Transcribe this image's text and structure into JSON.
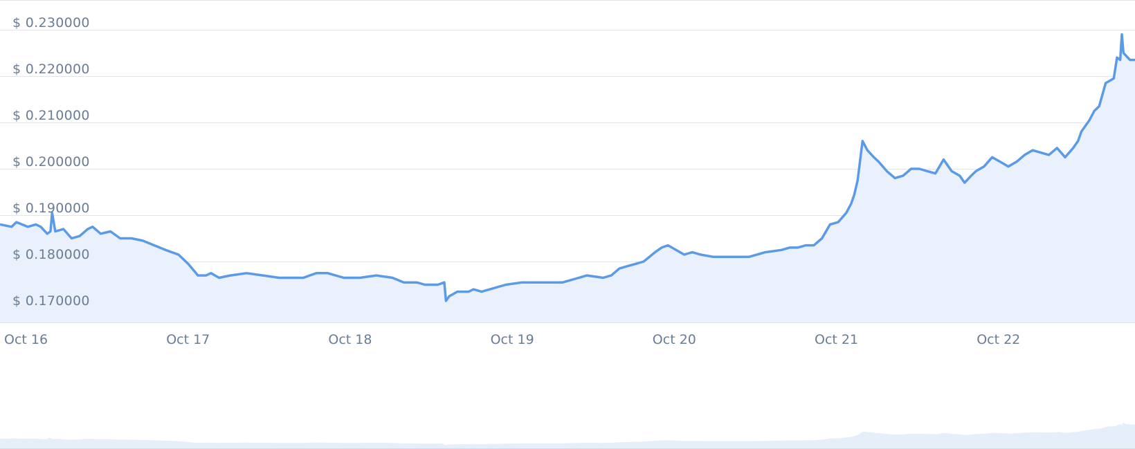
{
  "colors": {
    "line": "#5a9ae6",
    "area_fill": "#eaf1fc",
    "grid": "#e2e6eb",
    "axis_text": "#6b7c93",
    "navigator_fill": "#e6eefa"
  },
  "chart_data": {
    "type": "area",
    "title": "",
    "xlabel": "",
    "ylabel": "",
    "ylim": [
      0.167,
      0.235
    ],
    "grid": true,
    "y_tick_values": [
      0.17,
      0.18,
      0.19,
      0.2,
      0.21,
      0.22,
      0.23
    ],
    "y_tick_labels": [
      "$ 0.170000",
      "$ 0.180000",
      "$ 0.190000",
      "$ 0.200000",
      "$ 0.210000",
      "$ 0.220000",
      "$ 0.230000"
    ],
    "x_tick_values": [
      0,
      1,
      2,
      3,
      4,
      5,
      6
    ],
    "x_tick_labels": [
      "Oct 16",
      "Oct 17",
      "Oct 18",
      "Oct 19",
      "Oct 20",
      "Oct 21",
      "Oct 22"
    ],
    "xlim": [
      0,
      6.97
    ],
    "series": [
      {
        "x": [
          0,
          0.05,
          0.08,
          0.15,
          0.2,
          0.23,
          0.27,
          0.29,
          0.3,
          0.32,
          0.37,
          0.42,
          0.47,
          0.52,
          0.55,
          0.6,
          0.66,
          0.72,
          0.79,
          0.86,
          0.93,
          1.0,
          1.08,
          1.14,
          1.2,
          1.25,
          1.28,
          1.33,
          1.4,
          1.5,
          1.6,
          1.7,
          1.85,
          1.93,
          2.0,
          2.1,
          2.2,
          2.3,
          2.4,
          2.47,
          2.55,
          2.6,
          2.68,
          2.72,
          2.73,
          2.75,
          2.8,
          2.87,
          2.9,
          2.95,
          3.0,
          3.1,
          3.2,
          3.28,
          3.35,
          3.45,
          3.55,
          3.6,
          3.7,
          3.75,
          3.8,
          3.85,
          3.9,
          3.95,
          4.02,
          4.06,
          4.1,
          4.2,
          4.25,
          4.3,
          4.38,
          4.42,
          4.5,
          4.6,
          4.7,
          4.8,
          4.85,
          4.9,
          4.95,
          5.0,
          5.05,
          5.1,
          5.15,
          5.2,
          5.23,
          5.25,
          5.27,
          5.3,
          5.33,
          5.37,
          5.4,
          5.45,
          5.5,
          5.55,
          5.6,
          5.65,
          5.7,
          5.75,
          5.8,
          5.85,
          5.9,
          5.93,
          5.97,
          6.0,
          6.05,
          6.1,
          6.15,
          6.2,
          6.25,
          6.3,
          6.35,
          6.4,
          6.45,
          6.5,
          6.55,
          6.6,
          6.63,
          6.65,
          6.7,
          6.73,
          6.76,
          6.8,
          6.85,
          6.87,
          6.89,
          6.9,
          6.91,
          6.95,
          6.97
        ],
        "y": [
          0.188,
          0.1875,
          0.1885,
          0.1875,
          0.188,
          0.1875,
          0.186,
          0.1865,
          0.1905,
          0.1865,
          0.187,
          0.185,
          0.1855,
          0.187,
          0.1875,
          0.186,
          0.1865,
          0.185,
          0.185,
          0.1845,
          0.1835,
          0.1825,
          0.1815,
          0.1795,
          0.177,
          0.177,
          0.1775,
          0.1765,
          0.177,
          0.1775,
          0.177,
          0.1765,
          0.1765,
          0.1775,
          0.1775,
          0.1765,
          0.1765,
          0.177,
          0.1765,
          0.1755,
          0.1755,
          0.175,
          0.175,
          0.1755,
          0.1715,
          0.1725,
          0.1735,
          0.1735,
          0.174,
          0.1735,
          0.174,
          0.175,
          0.1755,
          0.1755,
          0.1755,
          0.1755,
          0.1765,
          0.177,
          0.1765,
          0.177,
          0.1785,
          0.179,
          0.1795,
          0.18,
          0.182,
          0.183,
          0.1835,
          0.1815,
          0.182,
          0.1815,
          0.181,
          0.181,
          0.181,
          0.181,
          0.182,
          0.1825,
          0.183,
          0.183,
          0.1835,
          0.1835,
          0.185,
          0.188,
          0.1885,
          0.1905,
          0.1925,
          0.1945,
          0.1975,
          0.206,
          0.204,
          0.2025,
          0.2015,
          0.1995,
          0.198,
          0.1985,
          0.2,
          0.2,
          0.1995,
          0.199,
          0.202,
          0.1995,
          0.1985,
          0.197,
          0.1985,
          0.1995,
          0.2005,
          0.2025,
          0.2015,
          0.2005,
          0.2015,
          0.203,
          0.204,
          0.2035,
          0.203,
          0.2045,
          0.2025,
          0.2045,
          0.206,
          0.208,
          0.2105,
          0.2125,
          0.2135,
          0.2185,
          0.2195,
          0.224,
          0.2235,
          0.229,
          0.225,
          0.2235,
          0.2235
        ]
      }
    ]
  }
}
